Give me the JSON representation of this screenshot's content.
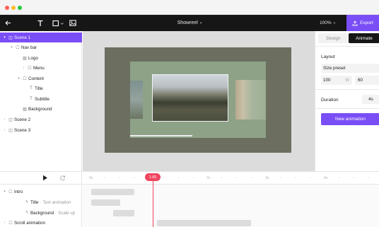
{
  "window": {
    "dot_colors": [
      "#fe5f57",
      "#febc2e",
      "#28c840"
    ]
  },
  "toolbar": {
    "title": "Showreel",
    "zoom": "100%",
    "export_label": "Export",
    "icons": [
      "back-arrow-icon",
      "text-tool-icon",
      "frame-tool-icon",
      "image-tool-icon"
    ]
  },
  "layers": [
    {
      "label": "Scene 1",
      "icon": "frame-icon",
      "expanded": true,
      "selected": true
    },
    {
      "label": "Nav bar",
      "icon": "frame-icon",
      "expanded": true
    },
    {
      "label": "Logo",
      "icon": "image-icon"
    },
    {
      "label": "Menu",
      "icon": "frame-icon",
      "expanded": false
    },
    {
      "label": "Content",
      "icon": "frame-icon",
      "expanded": true
    },
    {
      "label": "Title",
      "icon": "text-icon"
    },
    {
      "label": "Subtitle",
      "icon": "text-icon"
    },
    {
      "label": "Background",
      "icon": "image-icon"
    },
    {
      "label": "Scene 2",
      "icon": "frame-icon",
      "expanded": false
    },
    {
      "label": "Scene 3",
      "icon": "frame-icon",
      "expanded": false
    }
  ],
  "properties": {
    "tab_design": "Design",
    "tab_animate": "Animate",
    "active_tab": "Animate",
    "layout_label": "Layout",
    "size_preset_label": "Size preset",
    "width_value": "100",
    "width_unit": "W",
    "height_value": "60",
    "duration_label": "Duration",
    "duration_value": "4s",
    "new_animation_label": "New animation"
  },
  "timeline": {
    "playhead": "1.65",
    "ticks": [
      "0s",
      "1s",
      "2s",
      "3s",
      "4s"
    ],
    "tracks": [
      {
        "label": "Intro",
        "icon": "frame-icon",
        "expanded": true
      },
      {
        "label": "Title",
        "sub": "Text animation",
        "icon": "bolt-icon"
      },
      {
        "label": "Background",
        "sub": "Scale up",
        "icon": "bolt-icon"
      },
      {
        "label": "Scroll animation",
        "icon": "frame-icon",
        "expanded": false
      }
    ]
  },
  "colors": {
    "accent": "#7a4ef6",
    "playhead": "#f0455f",
    "toolbar": "#161616"
  }
}
